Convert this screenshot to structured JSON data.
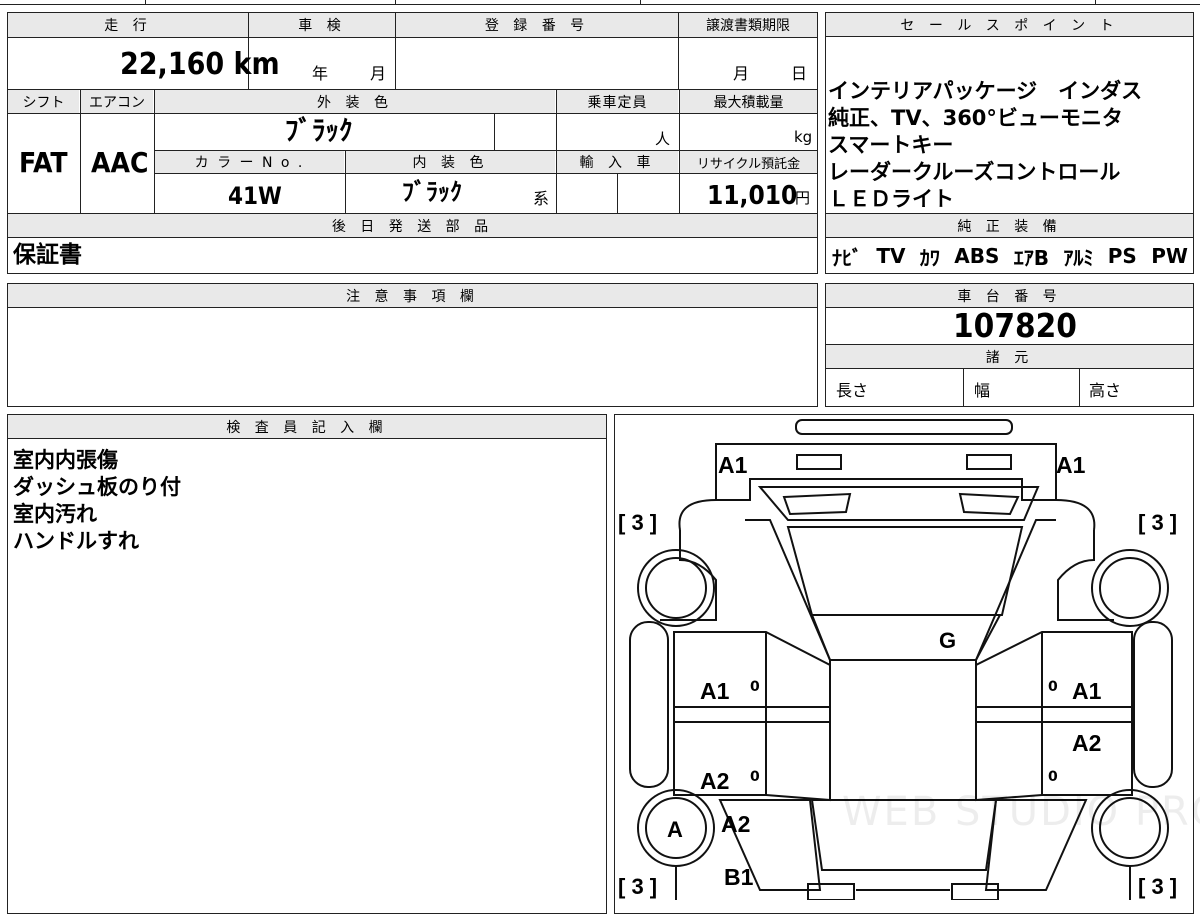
{
  "top_left": {
    "headers": {
      "mileage": "走 行",
      "inspection": "車 検",
      "registration": "登 録 番 号",
      "transfer_deadline": "譲渡書類期限",
      "shift": "シフト",
      "aircon": "エアコン",
      "exterior_color": "外 装 色",
      "capacity": "乗車定員",
      "max_load": "最大積載量",
      "color_no": "カ ラ ー N o .",
      "interior_color": "内 装 色",
      "imported": "輸 入 車",
      "recycle_fee": "リサイクル預託金",
      "later_parts": "後 日 発 送 部 品"
    },
    "values": {
      "mileage": "22,160 km",
      "inspection_year": "年",
      "inspection_month": "月",
      "deadline_month": "月",
      "deadline_day": "日",
      "shift": "FAT",
      "aircon": "AAC",
      "exterior_color": "ﾌﾞﾗｯｸ",
      "capacity_unit": "人",
      "max_load_unit": "kg",
      "color_no": "41W",
      "interior_color": "ﾌﾞﾗｯｸ",
      "interior_suffix": "系",
      "recycle_fee": "11,010",
      "recycle_unit": "円",
      "later_parts": "保証書"
    }
  },
  "sales_points": {
    "header": "セ ー ル ス ポ イ ン ト",
    "items": [
      "インテリアパッケージ　インダス",
      "純正、TV、360°ビューモニタ",
      "スマートキー",
      "レーダークルーズコントロール",
      "ＬＥＤライト"
    ]
  },
  "genuine_equipment": {
    "header": "純 正 装 備",
    "items": [
      "ﾅﾋﾞ",
      "TV",
      "ｶﾜ",
      "ABS",
      "ｴｱB",
      "ｱﾙﾐ",
      "PS",
      "PW"
    ]
  },
  "caution": {
    "header": "注 意 事 項 欄",
    "text": ""
  },
  "chassis": {
    "header": "車 台 番 号",
    "number": "107820",
    "spec_header": "諸 元",
    "length": "長さ",
    "width": "幅",
    "height": "高さ"
  },
  "inspector": {
    "header": "検 査 員 記 入 欄",
    "notes": [
      "室内内張傷",
      "ダッシュ板のり付",
      "室内汚れ",
      "ハンドルすれ"
    ]
  },
  "diagram": {
    "labels": {
      "front_left": "A1",
      "front_right": "A1",
      "corner_fl": "[ 3 ]",
      "corner_fr": "[ 3 ]",
      "corner_rl": "[ 3 ]",
      "corner_rr": "[ 3 ]",
      "glass": "G",
      "door_fl": "A1",
      "door_fl_mark": "0",
      "door_fr_mark": "0",
      "door_fr": "A1",
      "door_rr": "A2",
      "door_rl": "A2",
      "door_rl_mark": "0",
      "door_rr_mark": "0",
      "wheel_rl": "A",
      "quarter_l": "A2",
      "rear_l": "B1"
    },
    "watermark": "WEB STUDIO PRO"
  },
  "colors": {
    "header_bg": "#e9e9e9",
    "line": "#222222"
  }
}
